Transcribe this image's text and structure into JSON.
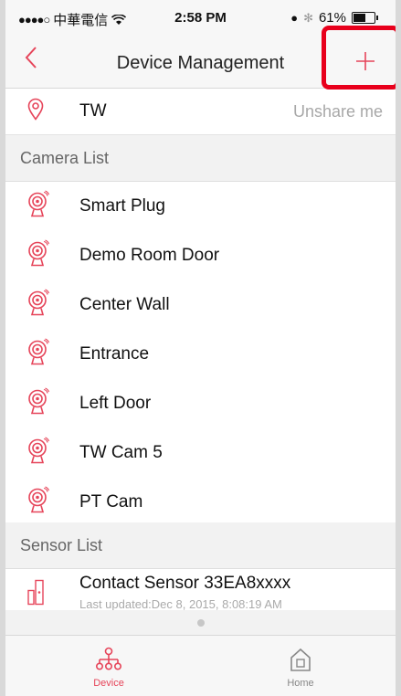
{
  "status_bar": {
    "carrier": "中華電信",
    "time": "2:58 PM",
    "battery": "61%",
    "battery_level": 0.61
  },
  "nav": {
    "back_label": "<",
    "title": "Device Management",
    "add_label": "+"
  },
  "location": {
    "name": "TW",
    "unshare_label": "Unshare me"
  },
  "camera_section": {
    "title": "Camera List"
  },
  "cameras": [
    {
      "name": "Smart Plug"
    },
    {
      "name": "Demo Room Door"
    },
    {
      "name": "Center Wall"
    },
    {
      "name": "Entrance"
    },
    {
      "name": "Left Door"
    },
    {
      "name": "TW Cam 5"
    },
    {
      "name": "PT Cam"
    }
  ],
  "sensor_section": {
    "title": "Sensor List"
  },
  "sensors": [
    {
      "name": "Contact Sensor 33EA8xxxx",
      "subtitle": "Last updated:Dec 8, 2015, 8:08:19 AM"
    }
  ],
  "tabs": [
    {
      "label": "Device",
      "icon": "device-tree-icon",
      "active": true
    },
    {
      "label": "Home",
      "icon": "home-icon",
      "active": false
    }
  ],
  "colors": {
    "accent": "#e6455a",
    "highlight": "#e8001c"
  }
}
